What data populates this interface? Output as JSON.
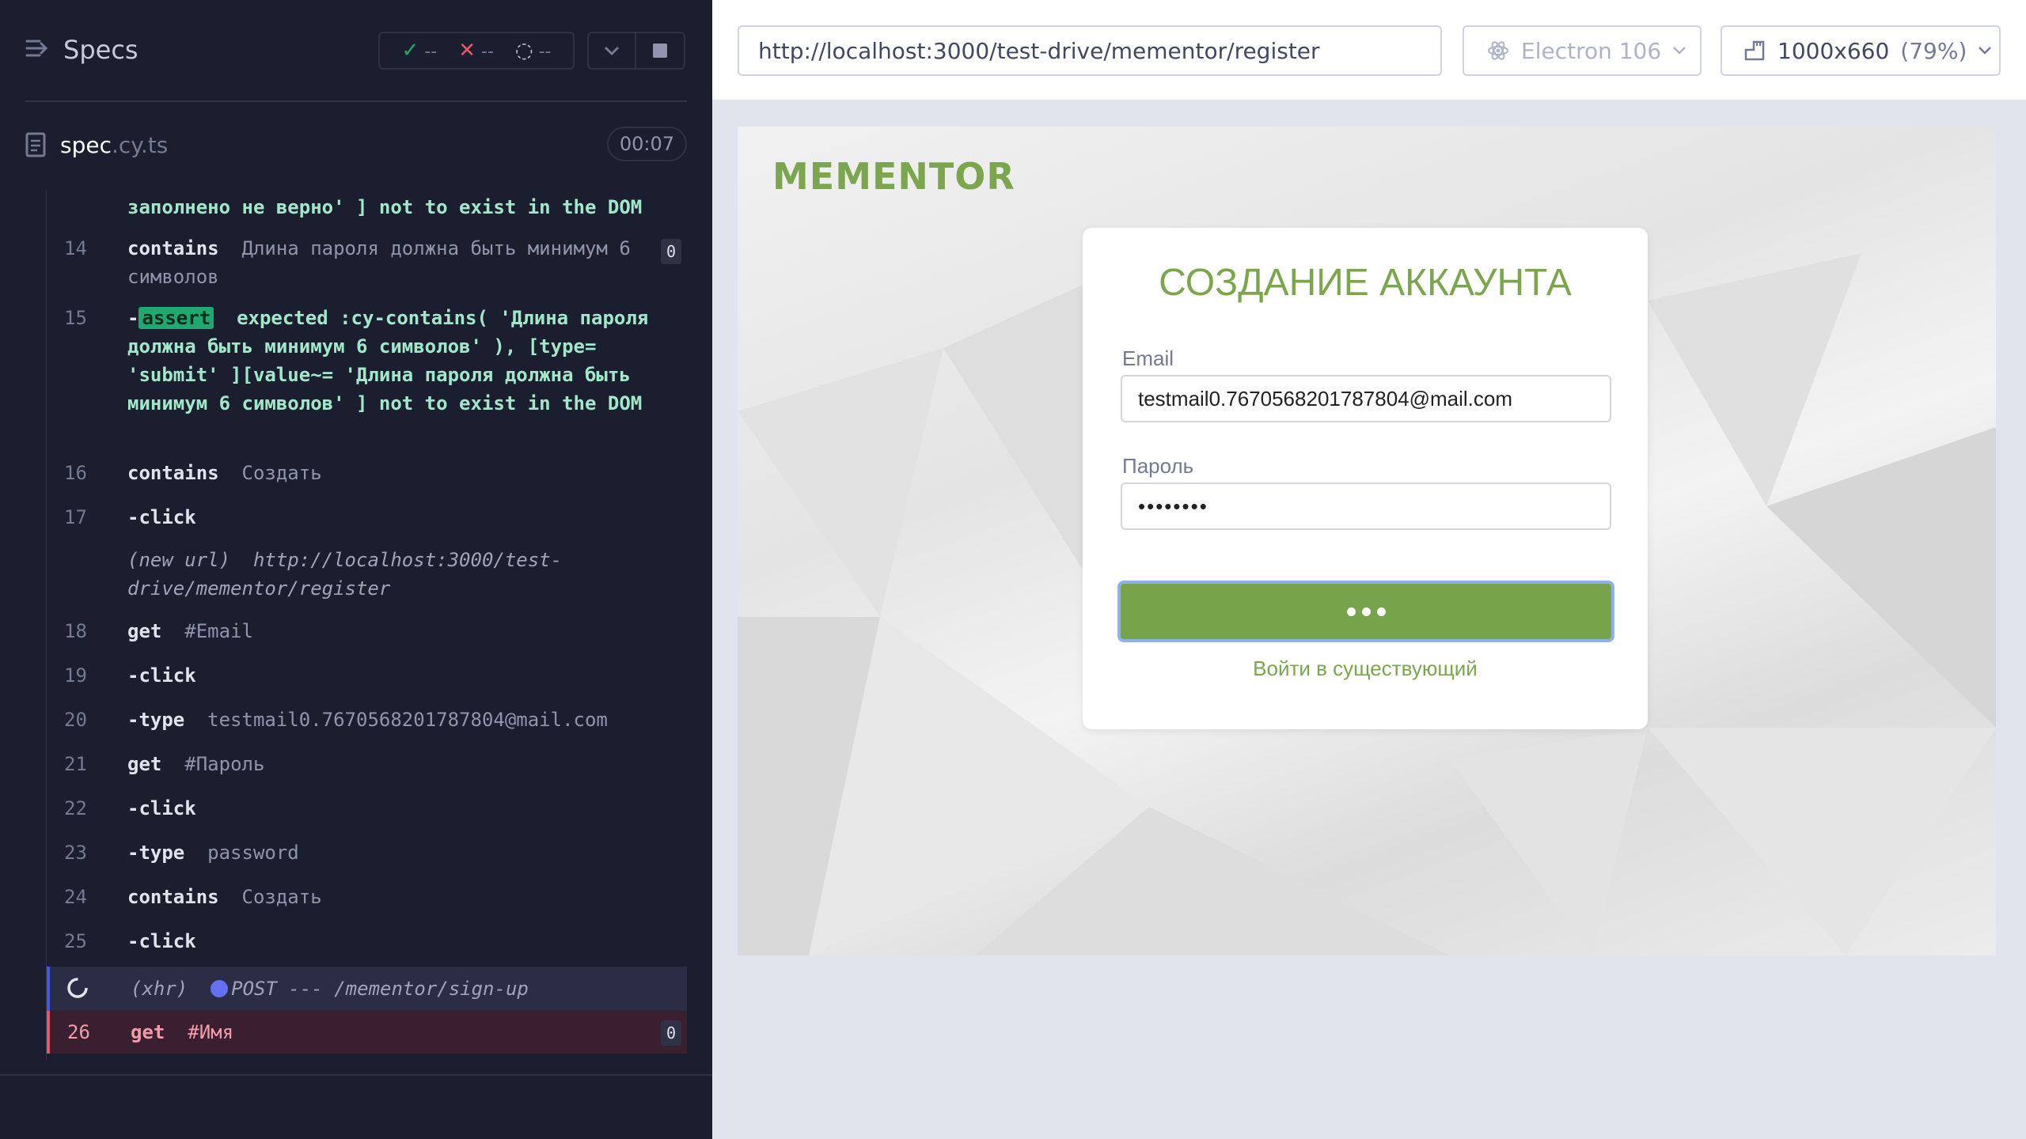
{
  "reporter": {
    "specs_label": "Specs",
    "stats": {
      "passed": "--",
      "failed": "--",
      "pending": "--"
    },
    "file": {
      "name": "spec",
      "ext": ".cy.ts",
      "timer": "00:07"
    },
    "log": {
      "partial_line": "заполнено не верно' ]",
      "partial_tail": "not to exist in the DOM",
      "rows": [
        {
          "num": "14",
          "cmd": "contains",
          "arg": "Длина пароля должна быть минимум 6 символов",
          "badge": "0"
        },
        {
          "num": "15",
          "prefix": "-",
          "tag": "assert",
          "text": "expected :cy-contains( 'Длина пароля должна быть минимум 6 символов' ), [type= 'submit' ][value~= 'Длина пароля должна быть минимум 6 символов' ] not to exist in the DOM"
        },
        {
          "num": "16",
          "cmd": "contains",
          "arg": "Создать"
        },
        {
          "num": "17",
          "cmd": "-click",
          "arg": ""
        },
        {
          "num": "",
          "note_a": "(new url)",
          "note_b": "http://localhost:3000/test-drive/mementor/register"
        },
        {
          "num": "18",
          "cmd": "get",
          "arg": "#Email"
        },
        {
          "num": "19",
          "cmd": "-click",
          "arg": ""
        },
        {
          "num": "20",
          "cmd": "-type",
          "arg": "testmail0.7670568201787804@mail.com"
        },
        {
          "num": "21",
          "cmd": "get",
          "arg": "#Пароль"
        },
        {
          "num": "22",
          "cmd": "-click",
          "arg": ""
        },
        {
          "num": "23",
          "cmd": "-type",
          "arg": "password"
        },
        {
          "num": "24",
          "cmd": "contains",
          "arg": "Создать"
        },
        {
          "num": "25",
          "cmd": "-click",
          "arg": ""
        }
      ],
      "xhr": {
        "kind": "(xhr)",
        "method": "POST",
        "status": "---",
        "path": "/mementor/sign-up"
      },
      "fail": {
        "num": "26",
        "cmd": "get",
        "arg": "#Имя",
        "badge": "0"
      }
    }
  },
  "aut": {
    "url": "http://localhost:3000/test-drive/mementor/register",
    "browser": "Electron 106",
    "viewport": "1000x660",
    "zoom": "(79%)"
  },
  "app": {
    "brand": "MEMENTOR",
    "title": "СОЗДАНИЕ АККАУНТА",
    "email_label": "Email",
    "email_value": "testmail0.7670568201787804@mail.com",
    "password_label": "Пароль",
    "password_value": "••••••••",
    "login_link": "Войти в существующий"
  },
  "colors": {
    "accent": "#7ba64e",
    "reporter_bg": "#1b1e2e",
    "fail": "#e45770",
    "pass": "#1fa971"
  }
}
